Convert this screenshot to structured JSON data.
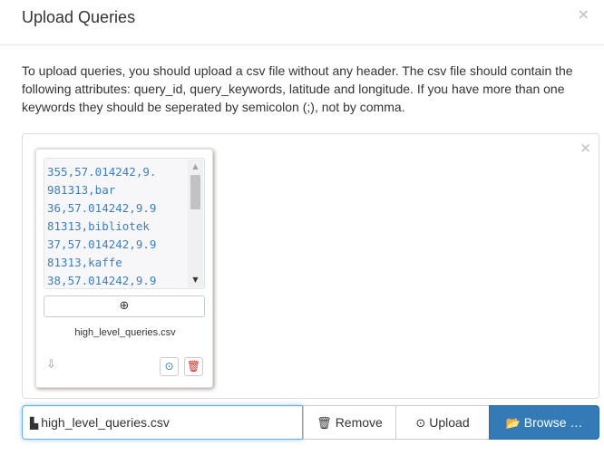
{
  "modal": {
    "title": "Upload Queries",
    "close_glyph": "×",
    "instructions": "To upload queries, you should upload a csv file without any header. The csv file should contain the following attributes: query_id, query_keywords, latitude and longitude. If you have more than one keywords they should be seperated by semicolon (;), not by comma."
  },
  "drop_zone": {
    "close_glyph": "×",
    "preview": {
      "content_lines": [
        "355,57.014242,9.",
        "981313,bar",
        "36,57.014242,9.9",
        "81313,bibliotek",
        "37,57.014242,9.9",
        "81313,kaffe",
        "38,57.014242,9.9"
      ],
      "zoom_icon": "zoom-in-icon",
      "zoom_glyph": "⊕",
      "file_name": "high_level_queries.csv",
      "drag_icon": "move-handle-icon",
      "drag_glyph": "⇩",
      "upload_icon": "upload-icon",
      "upload_glyph": "⊙",
      "remove_icon": "trash-icon",
      "remove_glyph": "🗑"
    }
  },
  "file_input": {
    "file_icon": "file-icon",
    "file_glyph": "▙",
    "caption": "high_level_queries.csv",
    "remove_glyph": "🗑",
    "remove_label": "Remove",
    "upload_glyph": "⊙",
    "upload_label": "Upload",
    "browse_glyph": "📂",
    "browse_label": "Browse …"
  },
  "colors": {
    "primary": "#337ab7",
    "code_text": "#3c7fbf",
    "danger": "#c9302c",
    "focus_border": "#66afe9"
  }
}
